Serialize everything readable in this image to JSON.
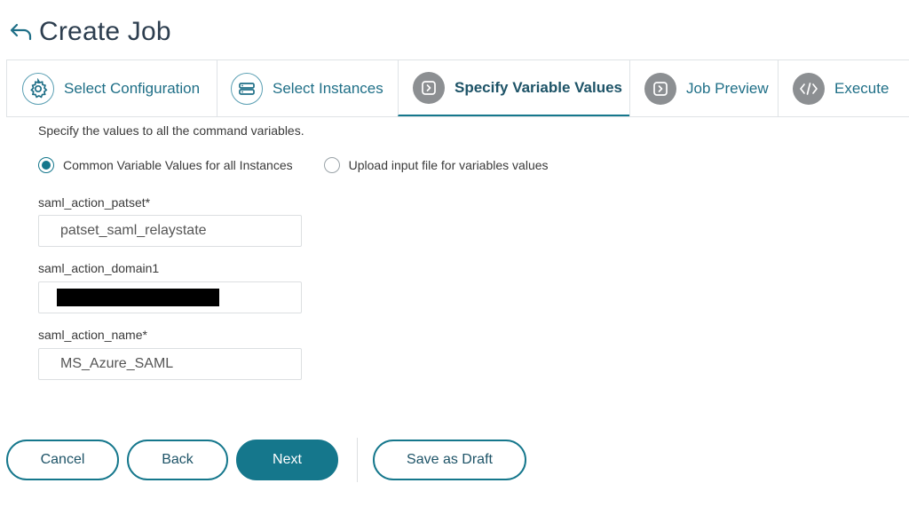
{
  "header": {
    "title": "Create Job"
  },
  "steps": [
    {
      "label": "Select Configuration",
      "icon": "gear-icon"
    },
    {
      "label": "Select Instances",
      "icon": "server-stack-icon"
    },
    {
      "label": "Specify Variable Values",
      "icon": "play-box-icon",
      "active": true
    },
    {
      "label": "Job Preview",
      "icon": "play-box-icon"
    },
    {
      "label": "Execute",
      "icon": "code-icon"
    }
  ],
  "description": "Specify the values to all the command variables.",
  "radios": {
    "common": {
      "label": "Common Variable Values for all Instances",
      "checked": true
    },
    "upload": {
      "label": "Upload input file for variables values",
      "checked": false
    }
  },
  "fields": [
    {
      "label": "saml_action_patset*",
      "value": "patset_saml_relaystate"
    },
    {
      "label": "saml_action_domain1",
      "value": ""
    },
    {
      "label": "saml_action_name*",
      "value": "MS_Azure_SAML"
    }
  ],
  "buttons": {
    "cancel": "Cancel",
    "back": "Back",
    "next": "Next",
    "save_draft": "Save as Draft"
  },
  "colors": {
    "accent": "#15778c",
    "title": "#2d3e4f",
    "step_icon_grey": "#8c8f92"
  }
}
